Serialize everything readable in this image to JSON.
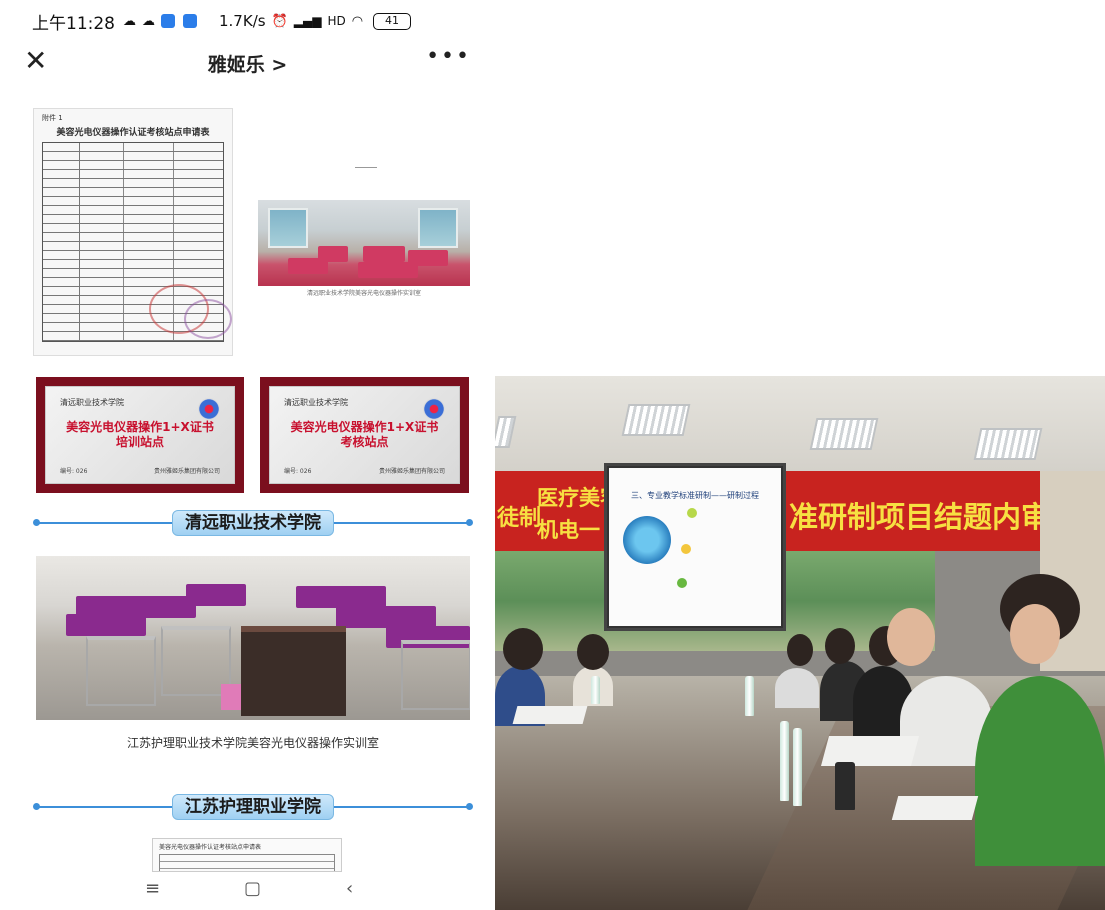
{
  "status_bar": {
    "time": "上午11:28",
    "speed": "1.7K/s",
    "signal_label": "HD",
    "battery": "41"
  },
  "nav": {
    "title": "雅姬乐 >",
    "more": "•••"
  },
  "form_doc": {
    "annex": "附件 1",
    "title": "美容光电仪器操作认证考核站点申请表"
  },
  "plaques": [
    {
      "school": "清远职业技术学院",
      "title_line1": "美容光电仪器操作1+X证书",
      "title_line2": "培训站点",
      "code": "编号: 026",
      "issuer": "贵州雅姬乐集团有限公司"
    },
    {
      "school": "清远职业技术学院",
      "title_line1": "美容光电仪器操作1+X证书",
      "title_line2": "考核站点",
      "code": "编号: 026",
      "issuer": "贵州雅姬乐集团有限公司"
    }
  ],
  "sections": {
    "qingyuan": "清远职业技术学院",
    "jiangsu": "江苏护理职业学院"
  },
  "captions": {
    "top_photo": "清远职业技术学院美容光电仪器操作实训室",
    "mid_photo": "江苏护理职业技术学院美容光电仪器操作实训室"
  },
  "doc_bottom": {
    "title": "美容光电仪器操作认证考核站点申请表"
  },
  "meeting": {
    "banner_main": "准研制项目结题内审会",
    "banner_left": "徒制",
    "banner_left_top": "医疗美容",
    "banner_left_bottom": "机电一",
    "screen_title": "三、专业教学标准研制——研制过程"
  },
  "colors": {
    "plaque_frame": "#7b0f1e",
    "plaque_text": "#c8102e",
    "divider": "#3c8fd9",
    "banner_red": "#c8231f",
    "banner_text": "#f7e042"
  }
}
